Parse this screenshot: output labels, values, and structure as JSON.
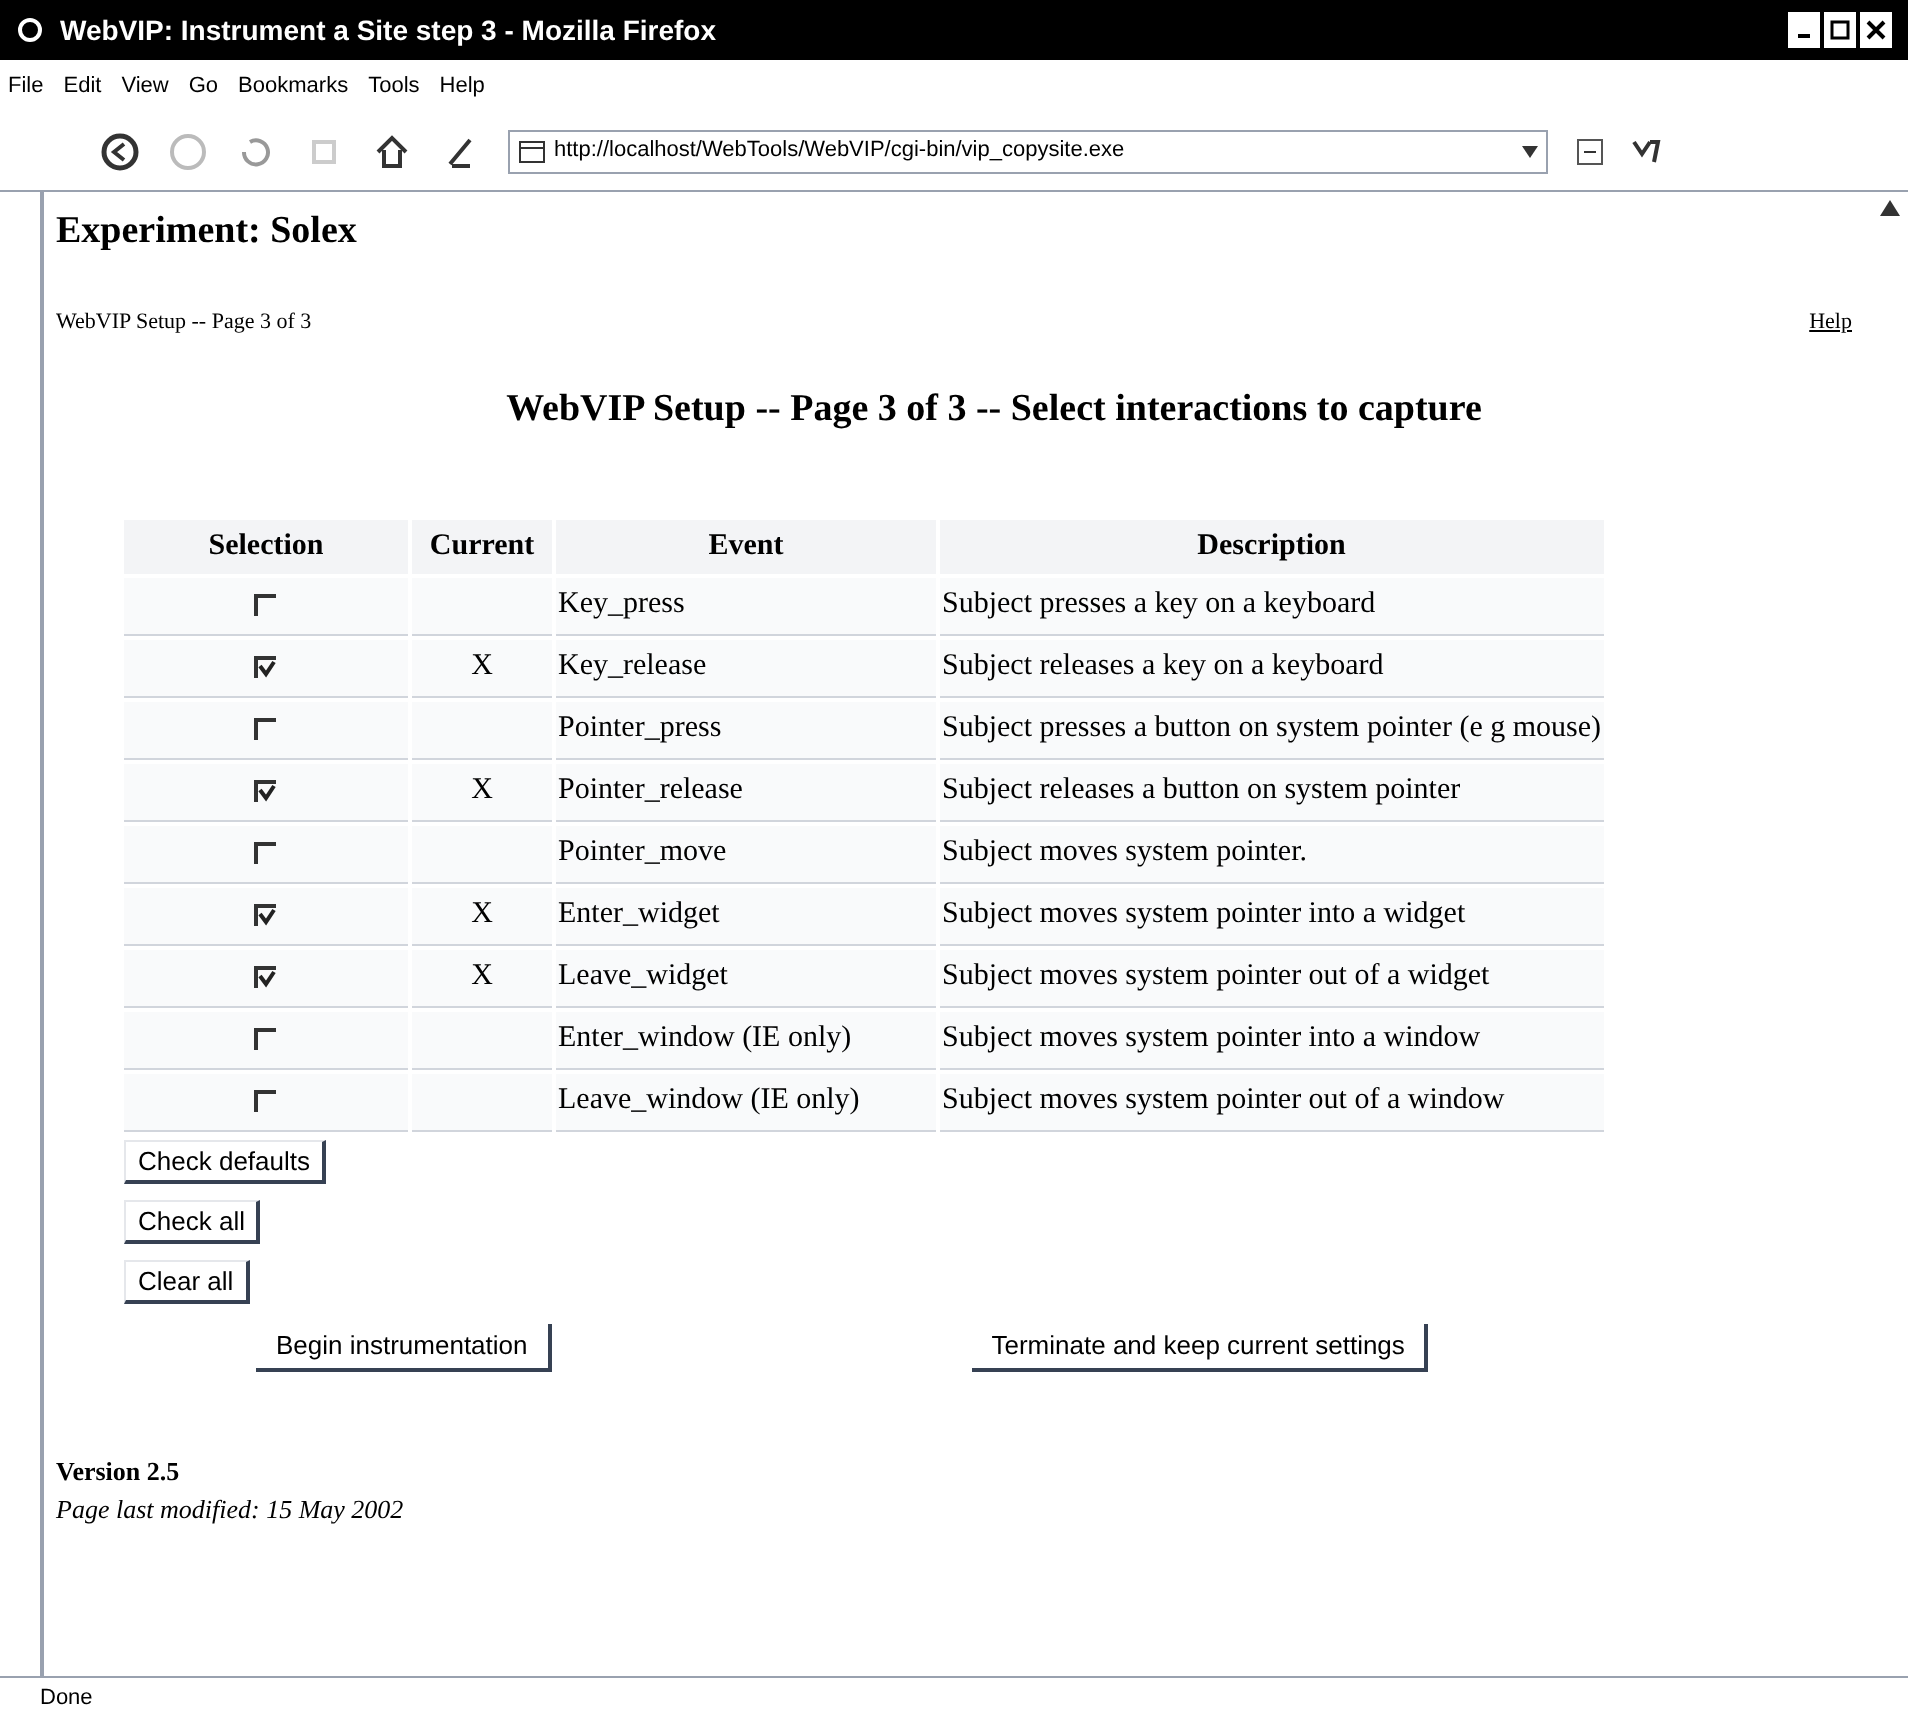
{
  "window": {
    "title": "WebVIP: Instrument a Site step 3 - Mozilla Firefox"
  },
  "menu": [
    "File",
    "Edit",
    "View",
    "Go",
    "Bookmarks",
    "Tools",
    "Help"
  ],
  "address": {
    "value": "http://localhost/WebTools/WebVIP/cgi-bin/vip_copysite.exe"
  },
  "page": {
    "heading": "Experiment: Solex",
    "breadcrumb": "WebVIP Setup -- Page 3 of 3",
    "help_link": "Help",
    "title": "WebVIP Setup -- Page 3 of 3 -- Select interactions to capture"
  },
  "table": {
    "columns": [
      "Selection",
      "Current",
      "Event",
      "Description"
    ],
    "rows": [
      {
        "checked": false,
        "event": "Key_press",
        "description": "Subject presses a key on a keyboard"
      },
      {
        "checked": true,
        "current": "X",
        "event": "Key_release",
        "description": "Subject releases a key on a keyboard"
      },
      {
        "checked": false,
        "event": "Pointer_press",
        "description": "Subject presses a button on system pointer (e g  mouse)"
      },
      {
        "checked": true,
        "current": "X",
        "event": "Pointer_release",
        "description": "Subject releases a button on system pointer"
      },
      {
        "checked": false,
        "event": "Pointer_move",
        "description": "Subject moves system pointer."
      },
      {
        "checked": true,
        "current": "X",
        "event": "Enter_widget",
        "description": "Subject moves system pointer into a widget"
      },
      {
        "checked": true,
        "current": "X",
        "event": "Leave_widget",
        "description": "Subject moves system pointer out of a widget"
      },
      {
        "checked": false,
        "event": "Enter_window (IE only)",
        "description": "Subject moves system pointer into a window"
      },
      {
        "checked": false,
        "event": "Leave_window (IE only)",
        "description": "Subject moves system pointer out of a window"
      }
    ]
  },
  "small_buttons": [
    "Check defaults",
    "Check all",
    "Clear all"
  ],
  "action_buttons": [
    "Begin instrumentation",
    "Terminate and keep current settings"
  ],
  "footer": {
    "version": "Version 2.5",
    "modified": "Page last modified: 15 May 2002"
  },
  "status_bar": "Done"
}
